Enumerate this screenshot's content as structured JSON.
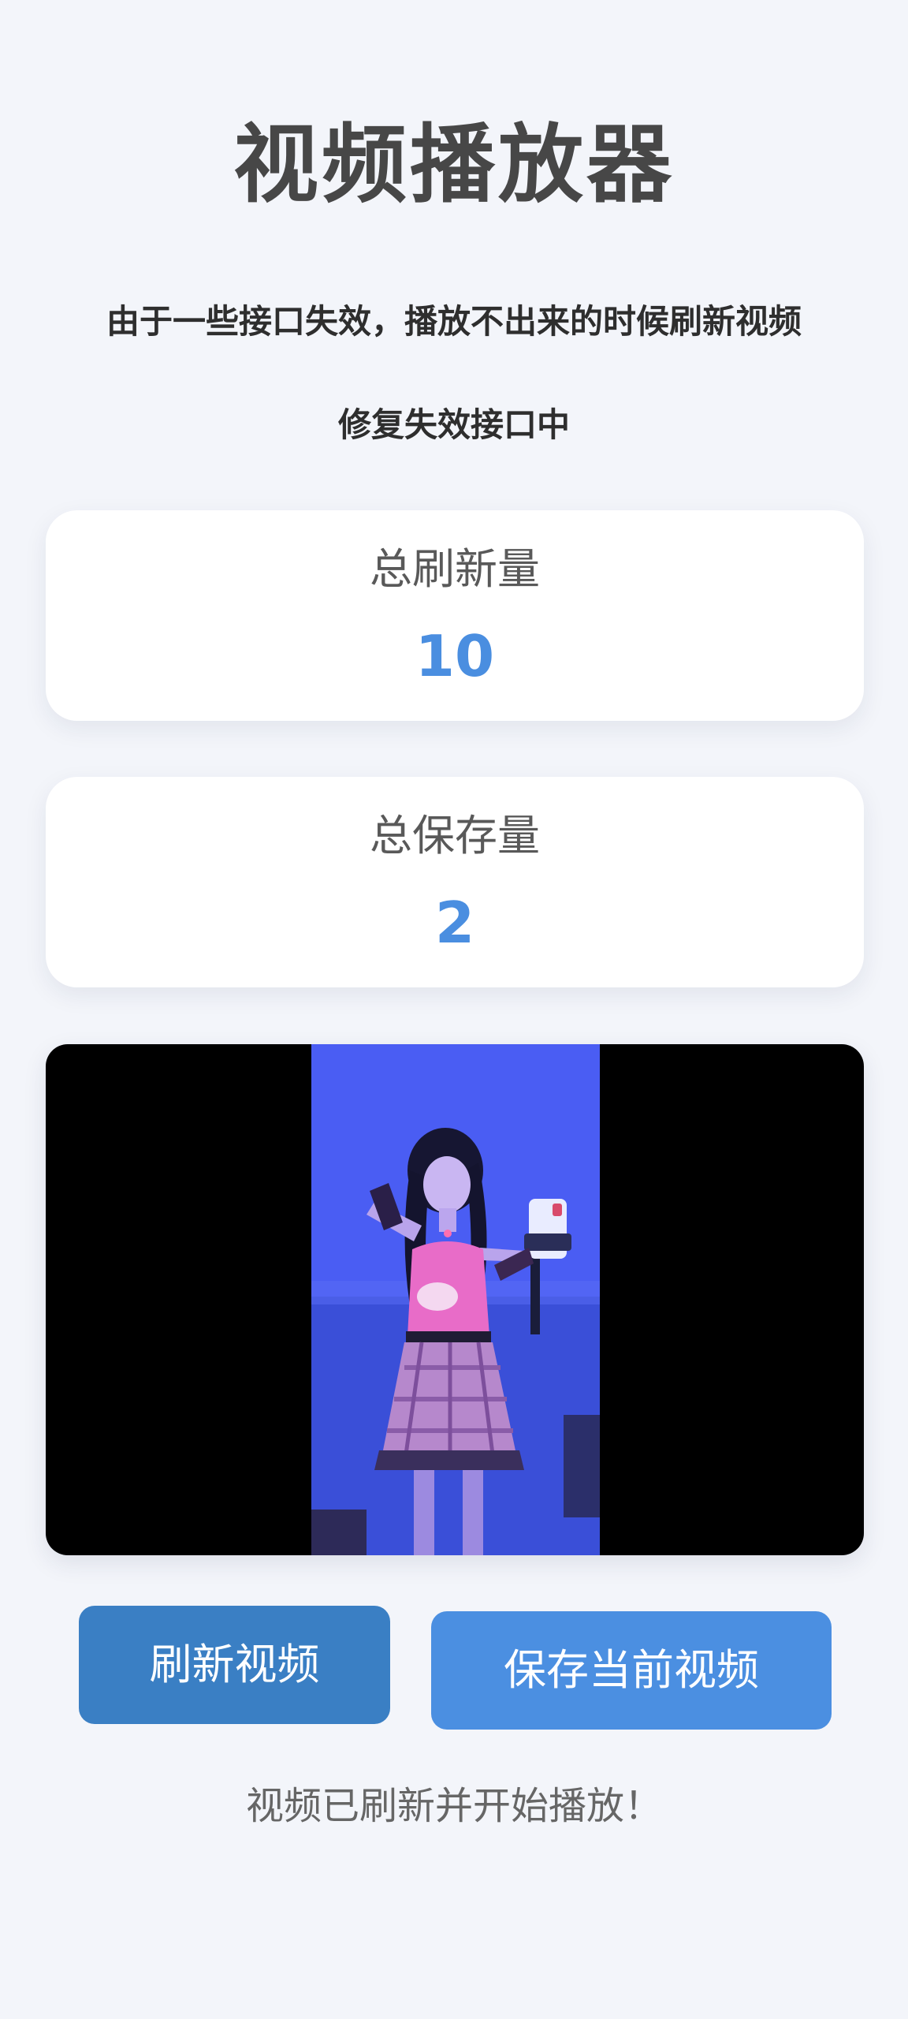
{
  "page": {
    "title": "视频播放器",
    "notice": "由于一些接口失效，播放不出来的时候刷新视频",
    "fixing": "修复失效接口中"
  },
  "stats": {
    "refresh_label": "总刷新量",
    "refresh_value": "10",
    "save_label": "总保存量",
    "save_value": "2"
  },
  "player": {
    "content": "video-frame"
  },
  "buttons": {
    "refresh": "刷新视频",
    "save": "保存当前视频"
  },
  "status": "视频已刷新并开始播放！",
  "colors": {
    "background": "#f3f5fa",
    "accent": "#4a8ee0",
    "refresh_button": "#3a7fc4",
    "save_button": "#4b8fe1"
  }
}
